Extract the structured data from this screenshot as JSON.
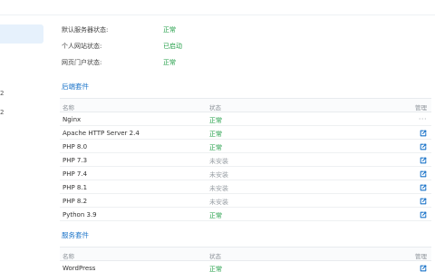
{
  "status": [
    {
      "label": "默认服务器状态:",
      "value": "正常"
    },
    {
      "label": "个人网站状态:",
      "value": "已启动"
    },
    {
      "label": "网页门户状态:",
      "value": "正常"
    }
  ],
  "backend": {
    "title": "后端套件",
    "headers": {
      "name": "名称",
      "status": "状态",
      "manage": "管理"
    },
    "rows": [
      {
        "name": "Nginx",
        "status": "正常",
        "state": "ok",
        "manage": "dots"
      },
      {
        "name": "Apache HTTP Server 2.4",
        "status": "正常",
        "state": "ok",
        "manage": "link"
      },
      {
        "name": "PHP 8.0",
        "status": "正常",
        "state": "ok",
        "manage": "link"
      },
      {
        "name": "PHP 7.3",
        "status": "未安装",
        "state": "off",
        "manage": "link"
      },
      {
        "name": "PHP 7.4",
        "status": "未安装",
        "state": "off",
        "manage": "link"
      },
      {
        "name": "PHP 8.1",
        "status": "未安装",
        "state": "off",
        "manage": "link"
      },
      {
        "name": "PHP 8.2",
        "status": "未安装",
        "state": "off",
        "manage": "link"
      },
      {
        "name": "Python 3.9",
        "status": "正常",
        "state": "ok",
        "manage": "link"
      }
    ]
  },
  "services": {
    "title": "服务套件",
    "headers": {
      "name": "名称",
      "status": "状态",
      "manage": "管理"
    },
    "rows": [
      {
        "name": "WordPress",
        "status": "正常",
        "state": "ok",
        "manage": "link"
      }
    ]
  },
  "sidebar": {
    "marks": [
      "2",
      "2"
    ]
  },
  "colors": {
    "ok": "#1f9d45",
    "off": "#9aa0a6",
    "accent": "#1a73c8",
    "link_icon": "#1a73c8"
  },
  "icons": {
    "manage_link": "external-link-icon",
    "manage_dots": "more-dots-icon"
  }
}
